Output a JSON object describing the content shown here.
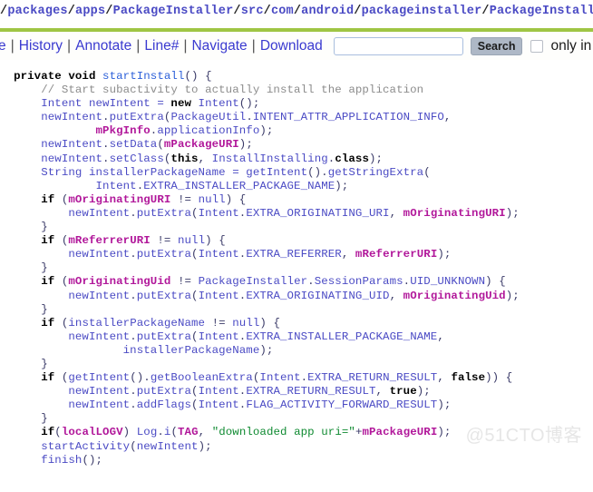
{
  "breadcrumb": {
    "leading_separator": "/",
    "segments": [
      "packages",
      "apps",
      "PackageInstaller",
      "src",
      "com",
      "android",
      "packageinstaller",
      "PackageInstallerAct"
    ],
    "truncated": true,
    "link_color": "#4a4ac4",
    "separator_color": "#262626"
  },
  "rule": {
    "color": "#9fc544"
  },
  "toolbar": {
    "clipped_left_link": "e",
    "links": [
      "History",
      "Annotate",
      "Line#",
      "Navigate",
      "Download"
    ],
    "separator": "|",
    "search": {
      "value": "",
      "placeholder": ""
    },
    "search_button_label": "Search",
    "scope_checkbox_checked": false,
    "scope_label": "only in Pa",
    "link_color": "#3a3ad0",
    "button_bg": "#aeb8c6"
  },
  "code": {
    "language": "java",
    "lines": [
      [
        [
          "pun",
          "  "
        ],
        [
          "kw",
          "private void "
        ],
        [
          "mth",
          "startInstall"
        ],
        [
          "pun",
          "() {"
        ]
      ],
      [
        [
          "pun",
          "      "
        ],
        [
          "com",
          "// Start subactivity to actually install the application"
        ]
      ],
      [
        [
          "pun",
          "      "
        ],
        [
          "id",
          "Intent newIntent = "
        ],
        [
          "kw",
          "new"
        ],
        [
          "id",
          " Intent"
        ],
        [
          "pun",
          "();"
        ]
      ],
      [
        [
          "pun",
          "      "
        ],
        [
          "id",
          "newIntent"
        ],
        [
          "pun",
          "."
        ],
        [
          "id",
          "putExtra"
        ],
        [
          "pun",
          "("
        ],
        [
          "id",
          "PackageUtil"
        ],
        [
          "pun",
          "."
        ],
        [
          "id",
          "INTENT_ATTR_APPLICATION_INFO"
        ],
        [
          "pun",
          ","
        ]
      ],
      [
        [
          "pun",
          "              "
        ],
        [
          "mem",
          "mPkgInfo"
        ],
        [
          "pun",
          "."
        ],
        [
          "id",
          "applicationInfo"
        ],
        [
          "pun",
          ");"
        ]
      ],
      [
        [
          "pun",
          "      "
        ],
        [
          "id",
          "newIntent"
        ],
        [
          "pun",
          "."
        ],
        [
          "id",
          "setData"
        ],
        [
          "pun",
          "("
        ],
        [
          "mem",
          "mPackageURI"
        ],
        [
          "pun",
          ");"
        ]
      ],
      [
        [
          "pun",
          "      "
        ],
        [
          "id",
          "newIntent"
        ],
        [
          "pun",
          "."
        ],
        [
          "id",
          "setClass"
        ],
        [
          "pun",
          "("
        ],
        [
          "kw",
          "this"
        ],
        [
          "pun",
          ", "
        ],
        [
          "id",
          "InstallInstalling"
        ],
        [
          "pun",
          "."
        ],
        [
          "kw",
          "class"
        ],
        [
          "pun",
          ");"
        ]
      ],
      [
        [
          "pun",
          "      "
        ],
        [
          "id",
          "String installerPackageName = getIntent"
        ],
        [
          "pun",
          "()."
        ],
        [
          "id",
          "getStringExtra"
        ],
        [
          "pun",
          "("
        ]
      ],
      [
        [
          "pun",
          "              "
        ],
        [
          "id",
          "Intent"
        ],
        [
          "pun",
          "."
        ],
        [
          "id",
          "EXTRA_INSTALLER_PACKAGE_NAME"
        ],
        [
          "pun",
          ");"
        ]
      ],
      [
        [
          "pun",
          "      "
        ],
        [
          "kw",
          "if"
        ],
        [
          "pun",
          " ("
        ],
        [
          "mem",
          "mOriginatingURI"
        ],
        [
          "pun",
          " != "
        ],
        [
          "id",
          "null"
        ],
        [
          "pun",
          ") {"
        ]
      ],
      [
        [
          "pun",
          "          "
        ],
        [
          "id",
          "newIntent"
        ],
        [
          "pun",
          "."
        ],
        [
          "id",
          "putExtra"
        ],
        [
          "pun",
          "("
        ],
        [
          "id",
          "Intent"
        ],
        [
          "pun",
          "."
        ],
        [
          "id",
          "EXTRA_ORIGINATING_URI"
        ],
        [
          "pun",
          ", "
        ],
        [
          "mem",
          "mOriginatingURI"
        ],
        [
          "pun",
          ");"
        ]
      ],
      [
        [
          "pun",
          "      }"
        ]
      ],
      [
        [
          "pun",
          "      "
        ],
        [
          "kw",
          "if"
        ],
        [
          "pun",
          " ("
        ],
        [
          "mem",
          "mReferrerURI"
        ],
        [
          "pun",
          " != "
        ],
        [
          "id",
          "null"
        ],
        [
          "pun",
          ") {"
        ]
      ],
      [
        [
          "pun",
          "          "
        ],
        [
          "id",
          "newIntent"
        ],
        [
          "pun",
          "."
        ],
        [
          "id",
          "putExtra"
        ],
        [
          "pun",
          "("
        ],
        [
          "id",
          "Intent"
        ],
        [
          "pun",
          "."
        ],
        [
          "id",
          "EXTRA_REFERRER"
        ],
        [
          "pun",
          ", "
        ],
        [
          "mem",
          "mReferrerURI"
        ],
        [
          "pun",
          ");"
        ]
      ],
      [
        [
          "pun",
          "      }"
        ]
      ],
      [
        [
          "pun",
          "      "
        ],
        [
          "kw",
          "if"
        ],
        [
          "pun",
          " ("
        ],
        [
          "mem",
          "mOriginatingUid"
        ],
        [
          "pun",
          " != "
        ],
        [
          "id",
          "PackageInstaller"
        ],
        [
          "pun",
          "."
        ],
        [
          "id",
          "SessionParams"
        ],
        [
          "pun",
          "."
        ],
        [
          "id",
          "UID_UNKNOWN"
        ],
        [
          "pun",
          ") {"
        ]
      ],
      [
        [
          "pun",
          "          "
        ],
        [
          "id",
          "newIntent"
        ],
        [
          "pun",
          "."
        ],
        [
          "id",
          "putExtra"
        ],
        [
          "pun",
          "("
        ],
        [
          "id",
          "Intent"
        ],
        [
          "pun",
          "."
        ],
        [
          "id",
          "EXTRA_ORIGINATING_UID"
        ],
        [
          "pun",
          ", "
        ],
        [
          "mem",
          "mOriginatingUid"
        ],
        [
          "pun",
          ");"
        ]
      ],
      [
        [
          "pun",
          "      }"
        ]
      ],
      [
        [
          "pun",
          "      "
        ],
        [
          "kw",
          "if"
        ],
        [
          "pun",
          " ("
        ],
        [
          "id",
          "installerPackageName"
        ],
        [
          "pun",
          " != "
        ],
        [
          "id",
          "null"
        ],
        [
          "pun",
          ") {"
        ]
      ],
      [
        [
          "pun",
          "          "
        ],
        [
          "id",
          "newIntent"
        ],
        [
          "pun",
          "."
        ],
        [
          "id",
          "putExtra"
        ],
        [
          "pun",
          "("
        ],
        [
          "id",
          "Intent"
        ],
        [
          "pun",
          "."
        ],
        [
          "id",
          "EXTRA_INSTALLER_PACKAGE_NAME"
        ],
        [
          "pun",
          ","
        ]
      ],
      [
        [
          "pun",
          "                  "
        ],
        [
          "id",
          "installerPackageName"
        ],
        [
          "pun",
          ");"
        ]
      ],
      [
        [
          "pun",
          "      }"
        ]
      ],
      [
        [
          "pun",
          "      "
        ],
        [
          "kw",
          "if"
        ],
        [
          "pun",
          " ("
        ],
        [
          "id",
          "getIntent"
        ],
        [
          "pun",
          "()."
        ],
        [
          "id",
          "getBooleanExtra"
        ],
        [
          "pun",
          "("
        ],
        [
          "id",
          "Intent"
        ],
        [
          "pun",
          "."
        ],
        [
          "id",
          "EXTRA_RETURN_RESULT"
        ],
        [
          "pun",
          ", "
        ],
        [
          "kw",
          "false"
        ],
        [
          "pun",
          ")) {"
        ]
      ],
      [
        [
          "pun",
          "          "
        ],
        [
          "id",
          "newIntent"
        ],
        [
          "pun",
          "."
        ],
        [
          "id",
          "putExtra"
        ],
        [
          "pun",
          "("
        ],
        [
          "id",
          "Intent"
        ],
        [
          "pun",
          "."
        ],
        [
          "id",
          "EXTRA_RETURN_RESULT"
        ],
        [
          "pun",
          ", "
        ],
        [
          "kw",
          "true"
        ],
        [
          "pun",
          ");"
        ]
      ],
      [
        [
          "pun",
          "          "
        ],
        [
          "id",
          "newIntent"
        ],
        [
          "pun",
          "."
        ],
        [
          "id",
          "addFlags"
        ],
        [
          "pun",
          "("
        ],
        [
          "id",
          "Intent"
        ],
        [
          "pun",
          "."
        ],
        [
          "id",
          "FLAG_ACTIVITY_FORWARD_RESULT"
        ],
        [
          "pun",
          ");"
        ]
      ],
      [
        [
          "pun",
          "      }"
        ]
      ],
      [
        [
          "pun",
          "      "
        ],
        [
          "kw",
          "if"
        ],
        [
          "pun",
          "("
        ],
        [
          "mem",
          "localLOGV"
        ],
        [
          "pun",
          ") "
        ],
        [
          "id",
          "Log"
        ],
        [
          "pun",
          "."
        ],
        [
          "id",
          "i"
        ],
        [
          "pun",
          "("
        ],
        [
          "mem",
          "TAG"
        ],
        [
          "pun",
          ", "
        ],
        [
          "str",
          "\"downloaded app uri=\""
        ],
        [
          "pun",
          "+"
        ],
        [
          "mem",
          "mPackageURI"
        ],
        [
          "pun",
          ");"
        ]
      ],
      [
        [
          "pun",
          "      "
        ],
        [
          "id",
          "startActivity"
        ],
        [
          "pun",
          "("
        ],
        [
          "id",
          "newIntent"
        ],
        [
          "pun",
          ");"
        ]
      ],
      [
        [
          "pun",
          "      "
        ],
        [
          "id",
          "finish"
        ],
        [
          "pun",
          "();"
        ]
      ],
      [
        [
          "pun",
          "  }"
        ]
      ]
    ]
  },
  "watermark": {
    "text": "@51CTO博客",
    "color": "#e6e6e6"
  }
}
